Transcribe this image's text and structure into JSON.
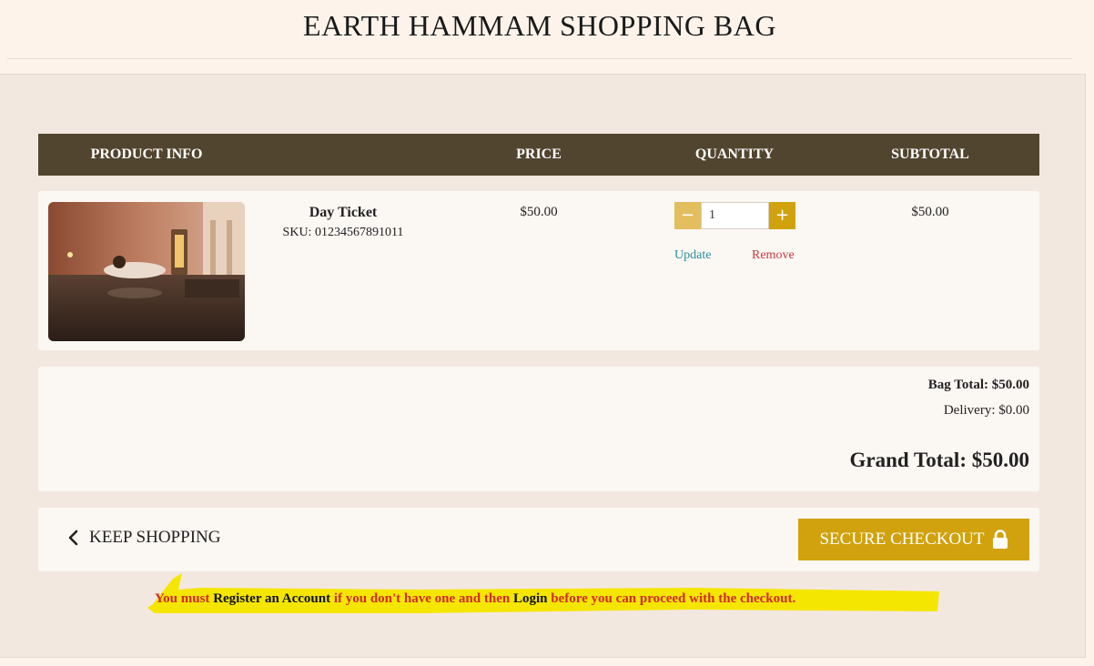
{
  "header": {
    "title": "EARTH HAMMAM SHOPPING BAG"
  },
  "table": {
    "columns": {
      "product": "PRODUCT INFO",
      "price": "PRICE",
      "quantity": "QUANTITY",
      "subtotal": "SUBTOTAL"
    },
    "items": [
      {
        "name": "Day Ticket",
        "sku": "SKU: 01234567891011",
        "price": "$50.00",
        "quantity": "1",
        "update_label": "Update",
        "remove_label": "Remove",
        "subtotal": "$50.00"
      }
    ]
  },
  "totals": {
    "bag_total": "Bag Total: $50.00",
    "delivery": "Delivery: $0.00",
    "grand_total": "Grand Total: $50.00"
  },
  "actions": {
    "keep_shopping": "KEEP SHOPPING",
    "secure_checkout": "SECURE CHECKOUT"
  },
  "notice": {
    "part1": "You must ",
    "register_link": "Register an Account",
    "part2": " if you don't have one and then ",
    "login_link": "Login",
    "part3": " before you can proceed with the checkout."
  },
  "colors": {
    "header_bar": "#52452f",
    "accent_gold": "#d1a20d",
    "update_link": "#2a8f9c",
    "remove_link": "#c8373d",
    "notice_text": "#d12b2b",
    "highlight": "#f5e600"
  },
  "icons": {
    "back": "chevron-left-icon",
    "lock": "lock-icon",
    "minus": "minus-icon",
    "plus": "plus-icon"
  }
}
